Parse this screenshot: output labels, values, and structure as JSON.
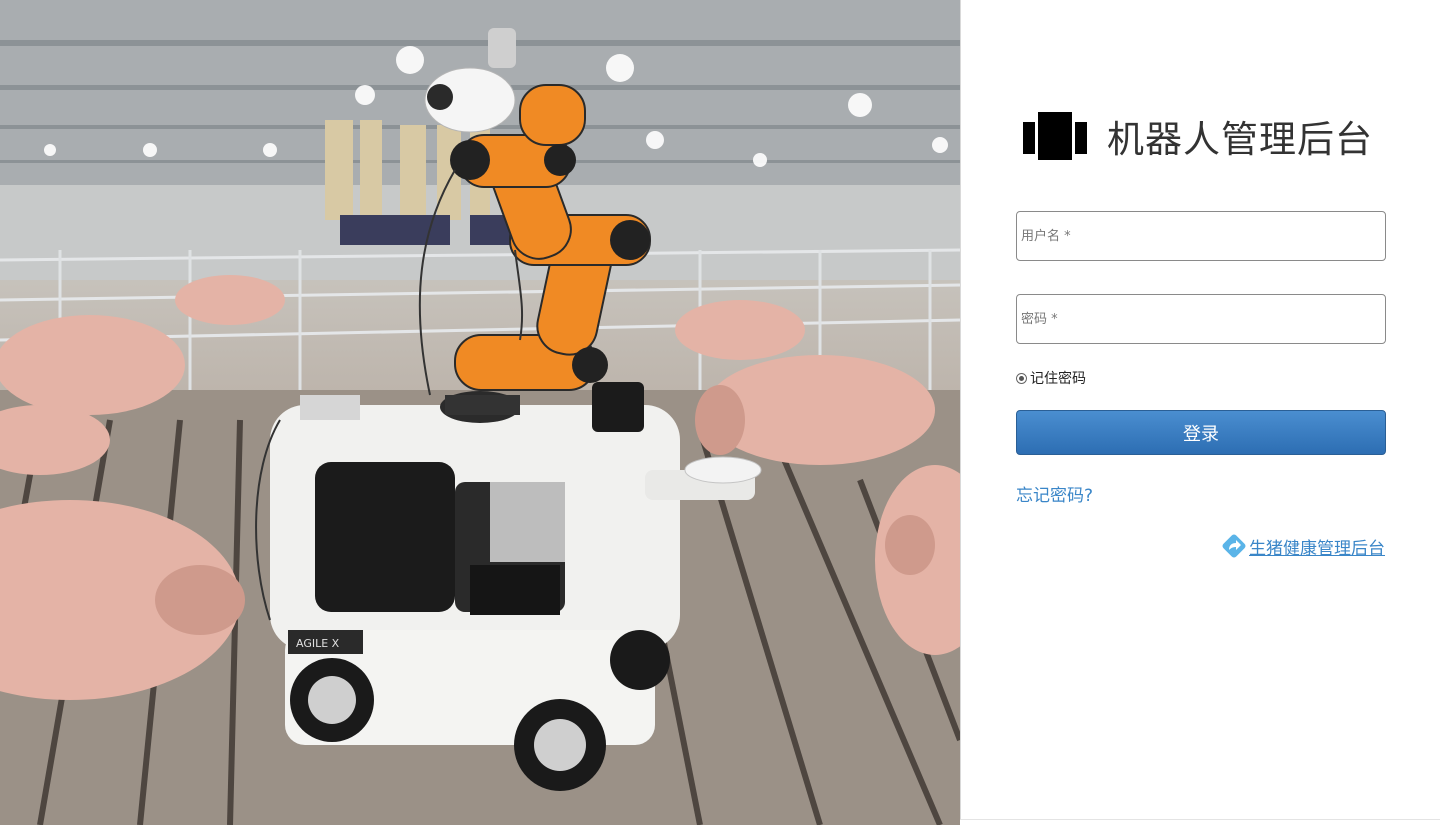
{
  "hero": {
    "photo": "pig-farm-inspection-robot",
    "robot_badge": "AGILE X"
  },
  "login": {
    "title": "机器人管理后台",
    "username_placeholder": "用户名 *",
    "password_placeholder": "密码 *",
    "remember_label": "记住密码",
    "remember_checked": true,
    "login_label": "登录",
    "forgot_label": "忘记密码?",
    "external_link_label": "生猪健康管理后台",
    "external_link_icon": "share-arrow-icon"
  },
  "colors": {
    "primary": "#3375b9",
    "link": "#3a86c8",
    "robot_arm": "#f08a24"
  }
}
